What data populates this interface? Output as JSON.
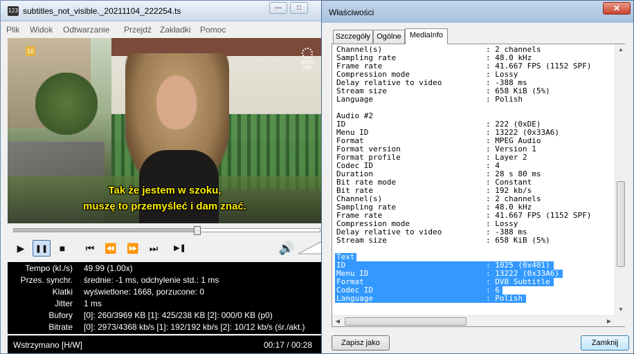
{
  "player": {
    "title": "subtitles_not_visible._20211104_222254.ts",
    "app_icon_text": "123",
    "min_glyph": "—",
    "max_glyph": "□",
    "menu": [
      "Plik",
      "Widok",
      "Odtwarzanie",
      "Przejdź",
      "Zakładki",
      "Pomoc"
    ],
    "video": {
      "age_badge": "16",
      "channel": "polsat cafe",
      "subtitle_line1": "Tak że jestem w szoku,",
      "subtitle_line2": "muszę to przemyśleć i dam znać."
    },
    "seek_fraction": 0.6,
    "controls": {
      "play": "▶",
      "pause": "❚❚",
      "stop": "■",
      "prev": "⏮",
      "rewind": "⏪",
      "forward": "⏩",
      "next": "⏭",
      "frame_step": "▶❚",
      "volume": "🔊"
    },
    "stats": [
      {
        "label": "Tempo (kl./s)",
        "value": "49.99 (1.00x)"
      },
      {
        "label": "Przes. synchr.",
        "value": "średnie: -1 ms, odchylenie std.: 1 ms"
      },
      {
        "label": "Klatki",
        "value": "wyświetlone: 1668, porzucone: 0"
      },
      {
        "label": "Jitter",
        "value": "1 ms"
      },
      {
        "label": "Bufory",
        "value": "[0]: 260/3969 KB [1]: 425/238 KB [2]: 000/0 KB (p0)"
      },
      {
        "label": "Bitrate",
        "value": "[0]: 2973/4368 kb/s [1]: 192/192 kb/s [2]: 10/12 kb/s (śr./akt.)"
      }
    ],
    "status": {
      "state": "Wstrzymano [H/W]",
      "time": "00:17 / 00:28"
    }
  },
  "properties": {
    "title": "Właściwości",
    "close_glyph": "✕",
    "tabs": [
      "Szczegóły",
      "Ogólne",
      "MediaInfo"
    ],
    "active_tab": "MediaInfo",
    "info_lines": [
      {
        "key": "Channel(s)",
        "value": ": 2 channels",
        "selected": false
      },
      {
        "key": "Sampling rate",
        "value": ": 48.0 kHz",
        "selected": false
      },
      {
        "key": "Frame rate",
        "value": ": 41.667 FPS (1152 SPF)",
        "selected": false
      },
      {
        "key": "Compression mode",
        "value": ": Lossy",
        "selected": false
      },
      {
        "key": "Delay relative to video",
        "value": ": -388 ms",
        "selected": false
      },
      {
        "key": "Stream size",
        "value": ": 658 KiB (5%)",
        "selected": false
      },
      {
        "key": "Language",
        "value": ": Polish",
        "selected": false
      },
      {
        "key": "",
        "value": "",
        "selected": false
      },
      {
        "key": "Audio #2",
        "value": "",
        "selected": false
      },
      {
        "key": "ID",
        "value": ": 222 (0xDE)",
        "selected": false
      },
      {
        "key": "Menu ID",
        "value": ": 13222 (0x33A6)",
        "selected": false
      },
      {
        "key": "Format",
        "value": ": MPEG Audio",
        "selected": false
      },
      {
        "key": "Format version",
        "value": ": Version 1",
        "selected": false
      },
      {
        "key": "Format profile",
        "value": ": Layer 2",
        "selected": false
      },
      {
        "key": "Codec ID",
        "value": ": 4",
        "selected": false
      },
      {
        "key": "Duration",
        "value": ": 28 s 80 ms",
        "selected": false
      },
      {
        "key": "Bit rate mode",
        "value": ": Constant",
        "selected": false
      },
      {
        "key": "Bit rate",
        "value": ": 192 kb/s",
        "selected": false
      },
      {
        "key": "Channel(s)",
        "value": ": 2 channels",
        "selected": false
      },
      {
        "key": "Sampling rate",
        "value": ": 48.0 kHz",
        "selected": false
      },
      {
        "key": "Frame rate",
        "value": ": 41.667 FPS (1152 SPF)",
        "selected": false
      },
      {
        "key": "Compression mode",
        "value": ": Lossy",
        "selected": false
      },
      {
        "key": "Delay relative to video",
        "value": ": -388 ms",
        "selected": false
      },
      {
        "key": "Stream size",
        "value": ": 658 KiB (5%)",
        "selected": false
      },
      {
        "key": "",
        "value": "",
        "selected": false
      },
      {
        "key": "Text",
        "value": "",
        "selected": true
      },
      {
        "key": "ID",
        "value": ": 1025 (0x401)",
        "selected": true
      },
      {
        "key": "Menu ID",
        "value": ": 13222 (0x33A6)",
        "selected": true
      },
      {
        "key": "Format",
        "value": ": DVB Subtitle",
        "selected": true
      },
      {
        "key": "Codec ID",
        "value": ": 6",
        "selected": true
      },
      {
        "key": "Language",
        "value": ": Polish",
        "selected": true
      }
    ],
    "buttons": {
      "save": "Zapisz jako",
      "close": "Zamknij"
    },
    "selection_color": "#3399ff"
  }
}
